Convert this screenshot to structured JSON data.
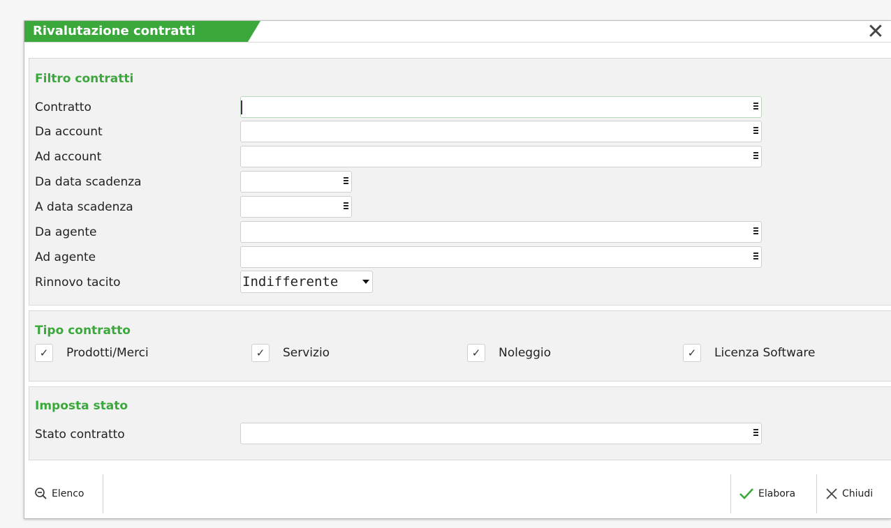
{
  "window": {
    "title": "Rivalutazione contratti",
    "close_glyph": "✕"
  },
  "filtro": {
    "title": "Filtro contratti",
    "fields": [
      {
        "label": "Contratto",
        "value": ""
      },
      {
        "label": "Da account",
        "value": ""
      },
      {
        "label": "Ad account",
        "value": ""
      },
      {
        "label": "Da data scadenza",
        "value": ""
      },
      {
        "label": "A data scadenza",
        "value": ""
      },
      {
        "label": "Da agente",
        "value": ""
      },
      {
        "label": "Ad agente",
        "value": ""
      }
    ],
    "rinnovo": {
      "label": "Rinnovo tacito",
      "value": "Indifferente"
    }
  },
  "tipo": {
    "title": "Tipo contratto",
    "options": [
      {
        "label": "Prodotti/Merci",
        "checked": true
      },
      {
        "label": "Servizio",
        "checked": true
      },
      {
        "label": "Noleggio",
        "checked": true
      },
      {
        "label": "Licenza Software",
        "checked": true
      }
    ]
  },
  "stato": {
    "title": "Imposta stato",
    "field": {
      "label": "Stato contratto",
      "value": ""
    }
  },
  "footer": {
    "elenco_label": "Elenco",
    "elabora_label": "Elabora",
    "chiudi_label": "Chiudi"
  },
  "colors": {
    "accent": "#3aa83b",
    "panel": "#f2f2f2"
  }
}
